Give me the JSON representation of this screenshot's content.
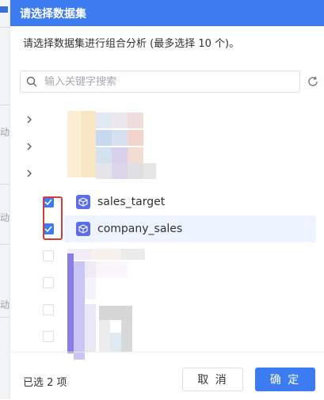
{
  "background": {
    "marks": [
      "动",
      "动",
      "动"
    ]
  },
  "dialog": {
    "title": "请选择数据集",
    "description": "请选择数据集进行组合分析 (最多选择 10 个)。",
    "search": {
      "placeholder": "输入关键字搜索",
      "value": ""
    }
  },
  "tree": {
    "items": [
      {
        "label": "sales_target",
        "checked": true
      },
      {
        "label": "company_sales",
        "checked": true
      }
    ]
  },
  "footer": {
    "selected_count": "已选 2 项",
    "cancel_label": "取 消",
    "confirm_label": "确 定"
  },
  "colors": {
    "primary": "#3d7cf0",
    "highlight_row": "#eef4ff",
    "dataset_icon": "#5b6de8",
    "annotation_box": "#d83a34"
  }
}
